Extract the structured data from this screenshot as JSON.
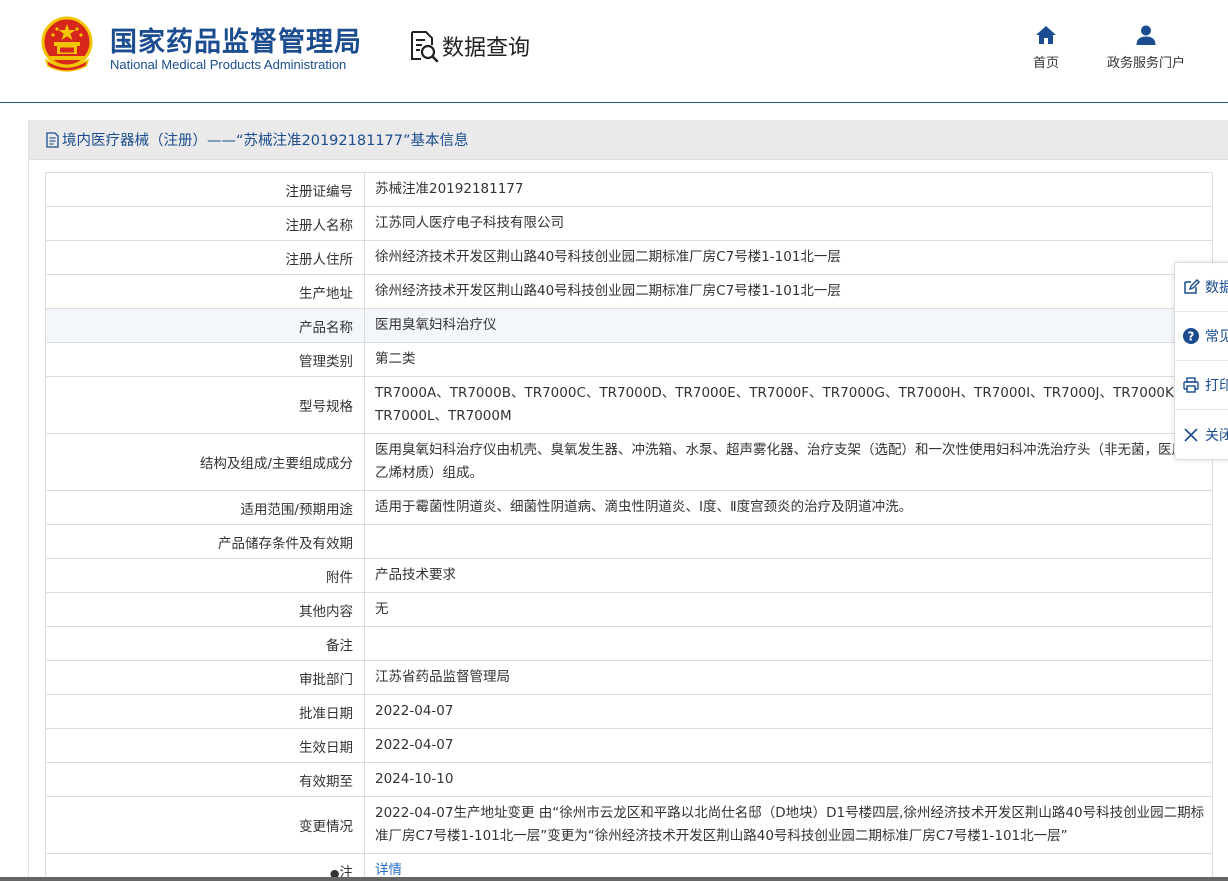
{
  "header": {
    "brand_cn": "国家药品监督管理局",
    "brand_en": "National Medical Products Administration",
    "query_label": "数据查询",
    "nav": [
      {
        "label": "首页",
        "icon": "home-icon"
      },
      {
        "label": "政务服务门户",
        "icon": "user-icon"
      }
    ]
  },
  "breadcrumb": {
    "text": "境内医疗器械（注册）——“苏械注准20192181177”基本信息",
    "icon": "document-icon"
  },
  "table": {
    "rows": [
      {
        "label": "注册证编号",
        "value": "苏械注准20192181177"
      },
      {
        "label": "注册人名称",
        "value": "江苏同人医疗电子科技有限公司"
      },
      {
        "label": "注册人住所",
        "value": "徐州经济技术开发区荆山路40号科技创业园二期标准厂房C7号楼1-101北一层"
      },
      {
        "label": "生产地址",
        "value": "徐州经济技术开发区荆山路40号科技创业园二期标准厂房C7号楼1-101北一层"
      },
      {
        "label": "产品名称",
        "value": "医用臭氧妇科治疗仪"
      },
      {
        "label": "管理类别",
        "value": "第二类"
      },
      {
        "label": "型号规格",
        "value": "TR7000A、TR7000B、TR7000C、TR7000D、TR7000E、TR7000F、TR7000G、TR7000H、TR7000I、TR7000J、TR7000K、TR7000L、TR7000M"
      },
      {
        "label": "结构及组成/主要组成成分",
        "value": "医用臭氧妇科治疗仪由机壳、臭氧发生器、冲洗箱、水泵、超声雾化器、治疗支架（选配）和一次性使用妇科冲洗治疗头（非无菌，医用聚乙烯材质）组成。"
      },
      {
        "label": "适用范围/预期用途",
        "value": "适用于霉菌性阴道炎、细菌性阴道病、滴虫性阴道炎、Ⅰ度、Ⅱ度宫颈炎的治疗及阴道冲洗。"
      },
      {
        "label": "产品储存条件及有效期",
        "value": ""
      },
      {
        "label": "附件",
        "value": "产品技术要求"
      },
      {
        "label": "其他内容",
        "value": "无"
      },
      {
        "label": "备注",
        "value": ""
      },
      {
        "label": "审批部门",
        "value": "江苏省药品监督管理局"
      },
      {
        "label": "批准日期",
        "value": "2022-04-07"
      },
      {
        "label": "生效日期",
        "value": "2022-04-07"
      },
      {
        "label": "有效期至",
        "value": "2024-10-10"
      },
      {
        "label": "变更情况",
        "value": "2022-04-07生产地址变更 由“徐州市云龙区和平路以北尚仕名邸（D地块）D1号楼四层,徐州经济技术开发区荆山路40号科技创业园二期标准厂房C7号楼1-101北一层”变更为“徐州经济技术开发区荆山路40号科技创业园二期标准厂房C7号楼1-101北一层”"
      },
      {
        "label": "注",
        "value": "详情"
      }
    ]
  },
  "side_tools": [
    {
      "label": "数据",
      "icon": "edit-icon"
    },
    {
      "label": "常见",
      "icon": "help-icon"
    },
    {
      "label": "打印",
      "icon": "print-icon"
    },
    {
      "label": "关闭",
      "icon": "close-icon"
    }
  ],
  "colors": {
    "brand": "#1a4c8f",
    "link": "#2a6ec6",
    "emblem_red": "#d7261c",
    "emblem_gold": "#f2c500"
  }
}
